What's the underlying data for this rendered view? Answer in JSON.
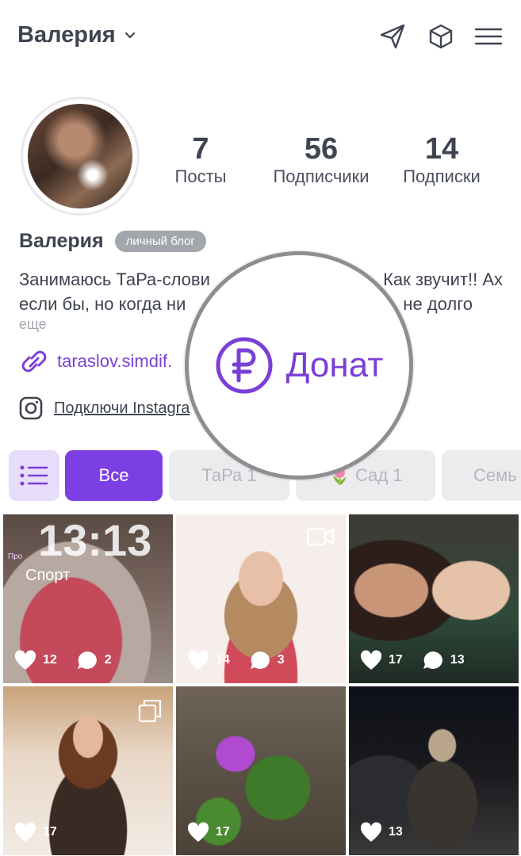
{
  "header": {
    "title": "Валерия",
    "icons": [
      "chevron-down-icon",
      "send-icon",
      "cube-icon",
      "menu-icon"
    ]
  },
  "profile": {
    "stats": [
      {
        "value": "7",
        "label": "Посты"
      },
      {
        "value": "56",
        "label": "Подписчики"
      },
      {
        "value": "14",
        "label": "Подписки"
      }
    ],
    "name": "Валерия",
    "badge": "личный блог",
    "bio_line1": "Занимаюсь ТаРа-слови",
    "bio_line1_end": "Как звучит!! Ах",
    "bio_line2": "если бы, но когда ни",
    "bio_line2_end": "не долго",
    "more": "еще",
    "link": "taraslov.simdif.",
    "instagram": "Подключи Instagra"
  },
  "tabs": [
    {
      "label": "Все",
      "active": true
    },
    {
      "label": "ТаРа 1",
      "active": false
    },
    {
      "label": "🌷 Сад 1",
      "active": false
    },
    {
      "label": "Семь",
      "active": false
    }
  ],
  "posts": [
    {
      "likes": "12",
      "comments": "2",
      "overlay_time": "13:13",
      "overlay_label": "Спорт",
      "overlay_tag": "Про"
    },
    {
      "likes": "14",
      "comments": "3"
    },
    {
      "likes": "17",
      "comments": "13"
    },
    {
      "likes": "17",
      "comments": ""
    },
    {
      "likes": "17",
      "comments": ""
    },
    {
      "likes": "13",
      "comments": ""
    }
  ],
  "donate": {
    "label": "Донат"
  },
  "colors": {
    "accent": "#7c3fe3",
    "text": "#3f4451",
    "muted": "#a3a6ad"
  }
}
